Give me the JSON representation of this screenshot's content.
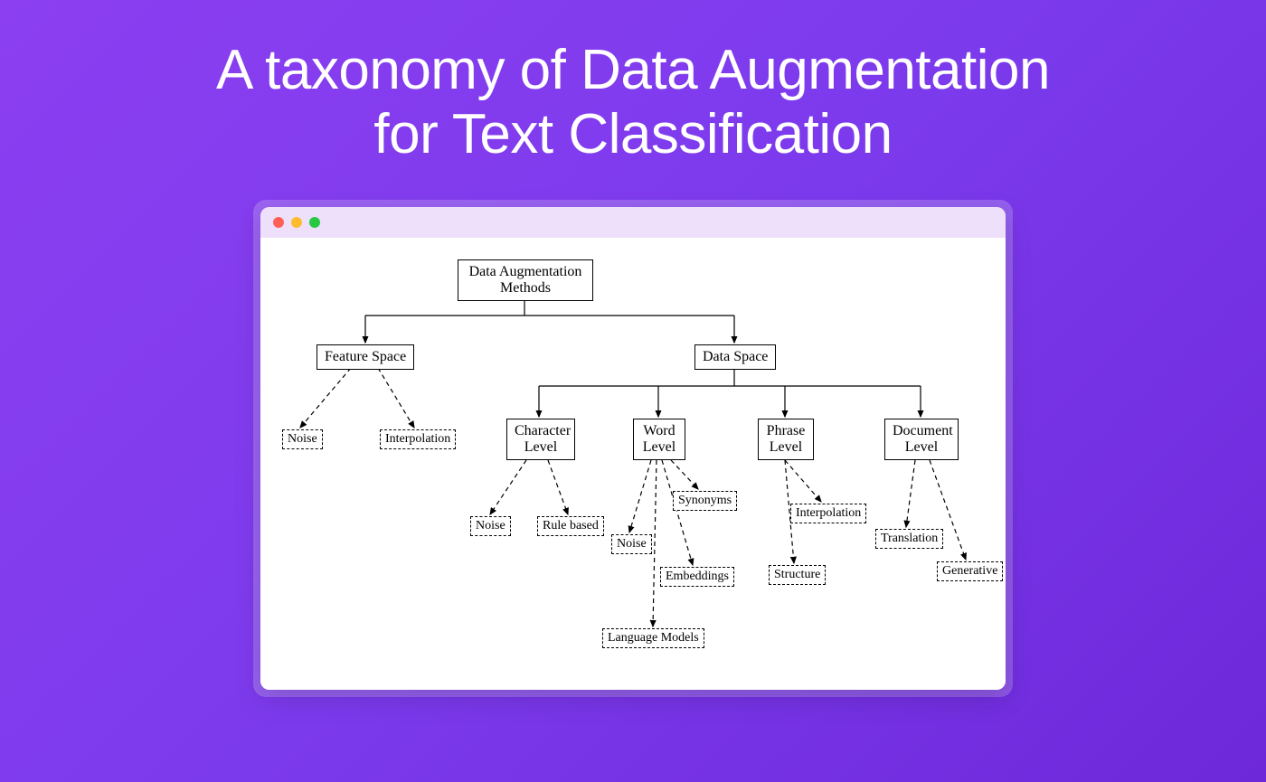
{
  "title_line1": "A taxonomy of Data Augmentation",
  "title_line2": "for Text Classification",
  "diagram": {
    "root": "Data Augmentation\nMethods",
    "feature_space": "Feature Space",
    "data_space": "Data Space",
    "fs_noise": "Noise",
    "fs_interpolation": "Interpolation",
    "character_level": "Character\nLevel",
    "word_level": "Word\nLevel",
    "phrase_level": "Phrase\nLevel",
    "document_level": "Document\nLevel",
    "cl_noise": "Noise",
    "cl_rule_based": "Rule based",
    "wl_synonyms": "Synonyms",
    "wl_noise": "Noise",
    "wl_embeddings": "Embeddings",
    "wl_language_models": "Language Models",
    "pl_interpolation": "Interpolation",
    "pl_structure": "Structure",
    "dl_translation": "Translation",
    "dl_generative": "Generative"
  }
}
